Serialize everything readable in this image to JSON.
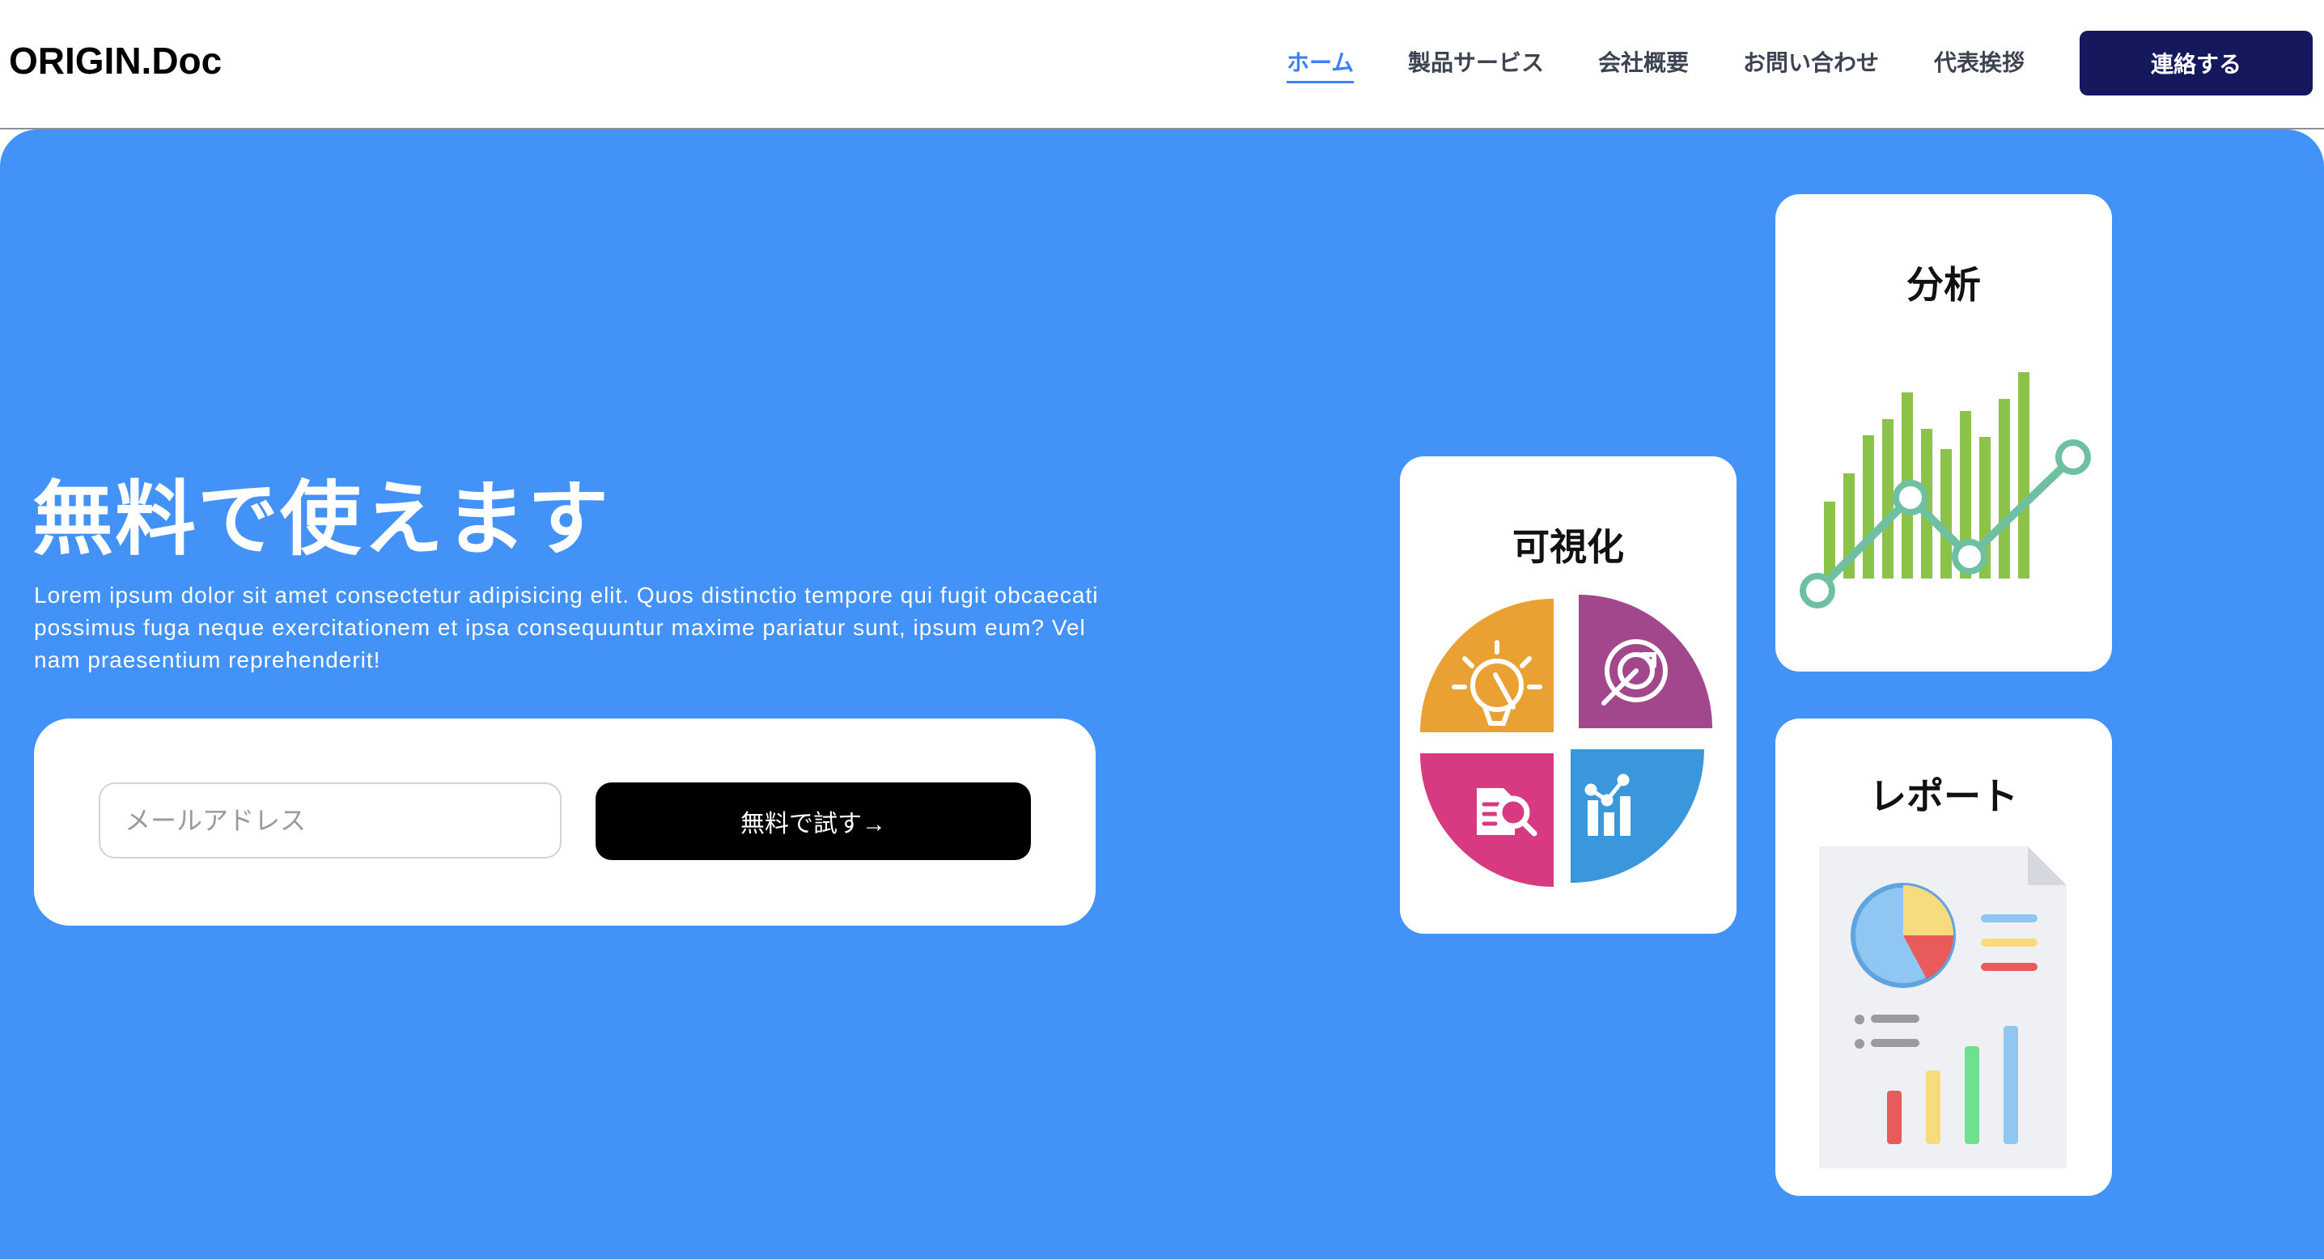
{
  "brand": {
    "logo": "ORIGIN.Doc"
  },
  "nav": {
    "items": [
      {
        "label": "ホーム",
        "active": true
      },
      {
        "label": "製品サービス",
        "active": false
      },
      {
        "label": "会社概要",
        "active": false
      },
      {
        "label": "お問い合わせ",
        "active": false
      },
      {
        "label": "代表挨拶",
        "active": false
      }
    ],
    "contact_button": "連絡する"
  },
  "hero": {
    "title": "無料で使えます",
    "description": "Lorem ipsum dolor sit amet consectetur adipisicing elit. Quos distinctio tempore qui fugit obcaecati possimus fuga neque exercitationem et ipsa consequuntur maxime pariatur sunt, ipsum eum? Vel nam praesentium reprehenderit!",
    "email": {
      "placeholder": "メールアドレス",
      "value": ""
    },
    "cta_button": "無料で試す→"
  },
  "features": [
    {
      "title": "可視化",
      "icon": "visualization-quadrant-icon"
    },
    {
      "title": "分析",
      "icon": "analytics-line-bar-icon"
    },
    {
      "title": "レポート",
      "icon": "report-document-icon"
    }
  ],
  "colors": {
    "hero_bg": "#4292f7",
    "contact_button_bg": "#16185e",
    "nav_active": "#3b82f6",
    "quadrant_orange": "#eaa133",
    "quadrant_purple": "#a2478c",
    "quadrant_pink": "#d83a82",
    "quadrant_blue": "#3a97db",
    "chart_green": "#8bc34a",
    "chart_teal": "#6fc0a0"
  }
}
